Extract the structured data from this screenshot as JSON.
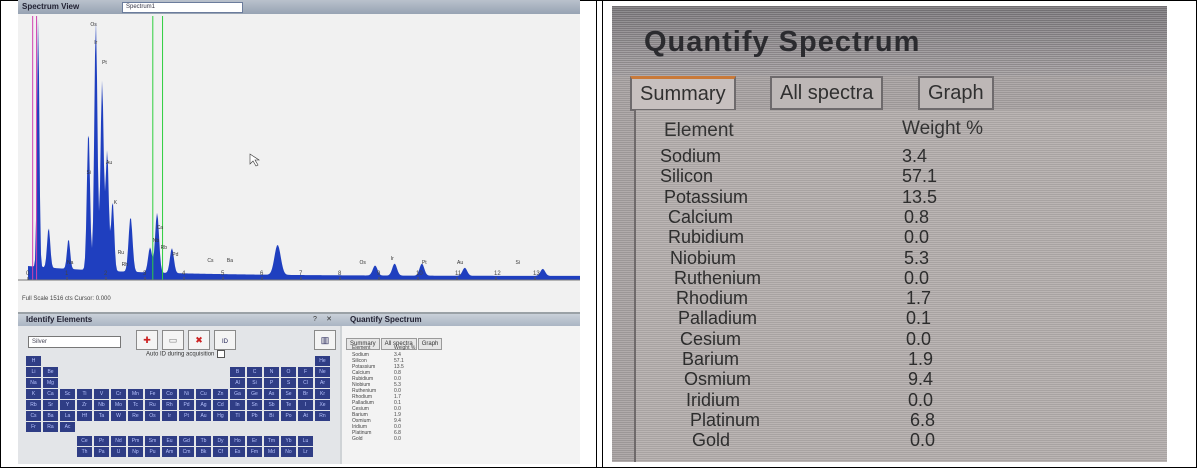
{
  "spectrum_view": {
    "title": "Spectrum View",
    "selector": "Spectrum1",
    "status": "Full Scale 1516 cts Cursor: 0.000",
    "x_ticks": [
      "0",
      "1",
      "2",
      "3",
      "4",
      "5",
      "6",
      "7",
      "8",
      "9",
      "10",
      "11",
      "12",
      "13"
    ],
    "peak_labels": [
      "Os",
      "Ir",
      "Pt",
      "Au",
      "Si",
      "K",
      "Ca",
      "Nb",
      "Rb",
      "Pd",
      "Ru",
      "Cs",
      "Ba",
      "Rh",
      "Na"
    ]
  },
  "identify_elements": {
    "title": "Identify Elements",
    "selector": "Silver",
    "auto_id_label": "Auto ID during acquisition",
    "toolbar_buttons": [
      "add",
      "remove",
      "delete",
      "ID",
      "chart"
    ],
    "periodic_symbols": [
      [
        "H",
        "",
        "",
        "",
        "",
        "",
        "",
        "",
        "",
        "",
        "",
        "",
        "",
        "",
        "",
        "",
        "",
        "He"
      ],
      [
        "Li",
        "Be",
        "",
        "",
        "",
        "",
        "",
        "",
        "",
        "",
        "",
        "",
        "B",
        "C",
        "N",
        "O",
        "F",
        "Ne"
      ],
      [
        "Na",
        "Mg",
        "",
        "",
        "",
        "",
        "",
        "",
        "",
        "",
        "",
        "",
        "Al",
        "Si",
        "P",
        "S",
        "Cl",
        "Ar"
      ],
      [
        "K",
        "Ca",
        "Sc",
        "Ti",
        "V",
        "Cr",
        "Mn",
        "Fe",
        "Co",
        "Ni",
        "Cu",
        "Zn",
        "Ga",
        "Ge",
        "As",
        "Se",
        "Br",
        "Kr"
      ],
      [
        "Rb",
        "Sr",
        "Y",
        "Zr",
        "Nb",
        "Mo",
        "Tc",
        "Ru",
        "Rh",
        "Pd",
        "Ag",
        "Cd",
        "In",
        "Sn",
        "Sb",
        "Te",
        "I",
        "Xe"
      ],
      [
        "Cs",
        "Ba",
        "La",
        "Hf",
        "Ta",
        "W",
        "Re",
        "Os",
        "Ir",
        "Pt",
        "Au",
        "Hg",
        "Tl",
        "Pb",
        "Bi",
        "Po",
        "At",
        "Rn"
      ],
      [
        "Fr",
        "Ra",
        "Ac",
        "",
        "",
        "",
        "",
        "",
        "",
        "",
        "",
        "",
        "",
        "",
        "",
        "",
        "",
        ""
      ]
    ],
    "lanthanides": [
      "Ce",
      "Pr",
      "Nd",
      "Pm",
      "Sm",
      "Eu",
      "Gd",
      "Tb",
      "Dy",
      "Ho",
      "Er",
      "Tm",
      "Yb",
      "Lu"
    ],
    "actinides": [
      "Th",
      "Pa",
      "U",
      "Np",
      "Pu",
      "Am",
      "Cm",
      "Bk",
      "Cf",
      "Es",
      "Fm",
      "Md",
      "No",
      "Lr"
    ]
  },
  "quantify_small": {
    "title": "Quantify Spectrum",
    "tabs": [
      "Summary",
      "All spectra",
      "Graph"
    ],
    "header_element": "Element",
    "header_weight": "Weight %"
  },
  "quantify_large": {
    "title": "Quantify Spectrum",
    "tabs": [
      "Summary",
      "All spectra",
      "Graph"
    ],
    "header_element": "Element",
    "header_weight": "Weight %"
  },
  "results": [
    {
      "element": "Sodium",
      "weight": "3.4"
    },
    {
      "element": "Silicon",
      "weight": "57.1"
    },
    {
      "element": "Potassium",
      "weight": "13.5"
    },
    {
      "element": "Calcium",
      "weight": "0.8"
    },
    {
      "element": "Rubidium",
      "weight": "0.0"
    },
    {
      "element": "Niobium",
      "weight": "5.3"
    },
    {
      "element": "Ruthenium",
      "weight": "0.0"
    },
    {
      "element": "Rhodium",
      "weight": "1.7"
    },
    {
      "element": "Palladium",
      "weight": "0.1"
    },
    {
      "element": "Cesium",
      "weight": "0.0"
    },
    {
      "element": "Barium",
      "weight": "1.9"
    },
    {
      "element": "Osmium",
      "weight": "9.4"
    },
    {
      "element": "Iridium",
      "weight": "0.0"
    },
    {
      "element": "Platinum",
      "weight": "6.8"
    },
    {
      "element": "Gold",
      "weight": "0.0"
    }
  ],
  "colors": {
    "spectrum_fill": "#1f3fbf",
    "marker_green": "#2fcf3f",
    "marker_pink": "#d040b0",
    "periodic_cell": "#2f3d85",
    "active_tab_accent": "#c97a3a"
  }
}
